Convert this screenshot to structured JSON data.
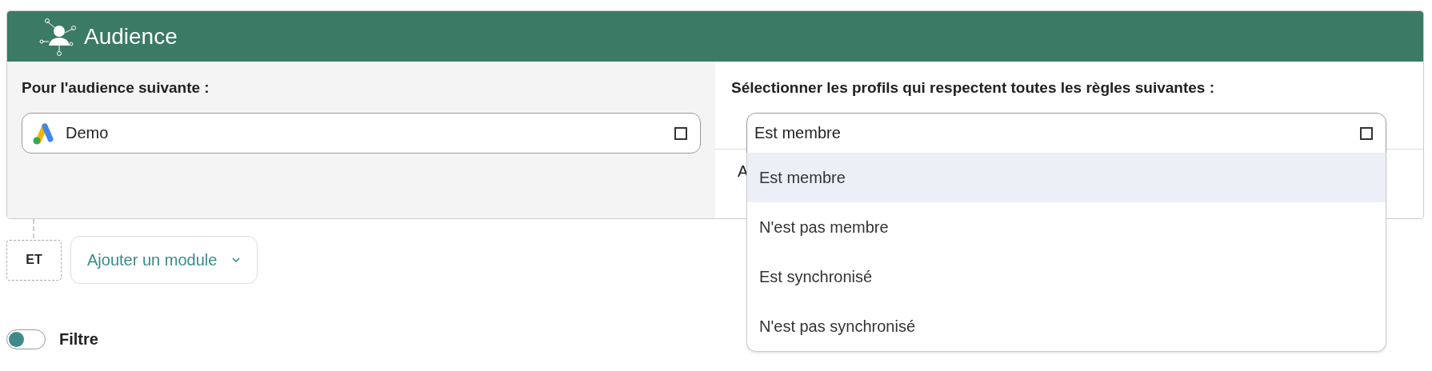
{
  "header": {
    "title": "Audience"
  },
  "left": {
    "heading": "Pour l'audience suivante :",
    "select": {
      "value": "Demo"
    }
  },
  "right": {
    "heading": "Sélectionner les profils qui respectent toutes les règles suivantes :",
    "select": {
      "value": "Est membre",
      "expanded": true
    },
    "hidden_text": "A",
    "options": [
      {
        "label": "Est membre",
        "selected": true
      },
      {
        "label": "N'est pas membre",
        "selected": false
      },
      {
        "label": "Est synchronisé",
        "selected": false
      },
      {
        "label": "N'est pas synchronisé",
        "selected": false
      }
    ]
  },
  "connector": {
    "label": "ET"
  },
  "add_module": {
    "label": "Ajouter un module"
  },
  "filter": {
    "label": "Filtre",
    "on": false
  }
}
